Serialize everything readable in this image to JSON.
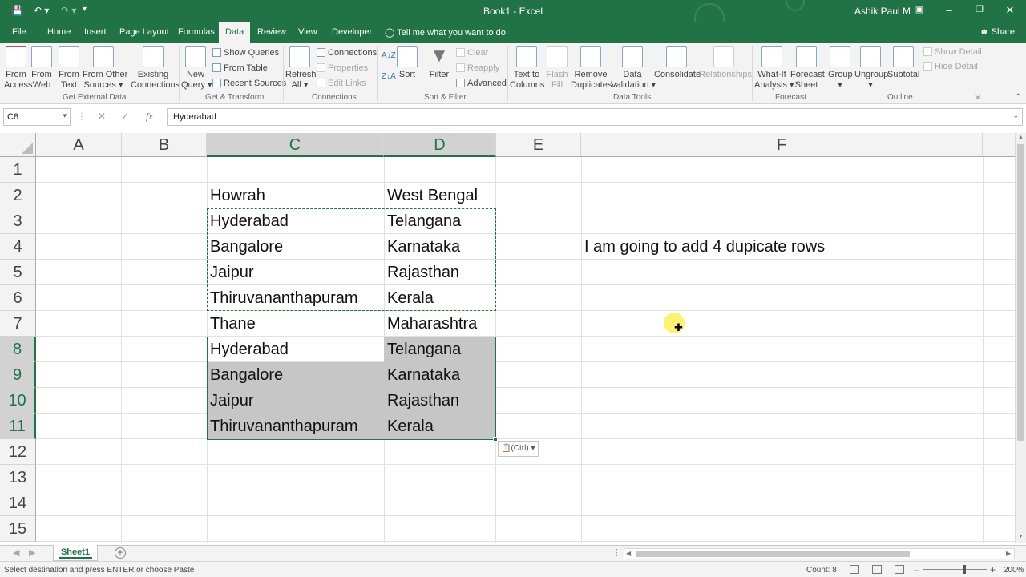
{
  "window": {
    "title": "Book1 - Excel",
    "user": "Ashik Paul M",
    "accent": "#217346"
  },
  "tabs": [
    "File",
    "Home",
    "Insert",
    "Page Layout",
    "Formulas",
    "Data",
    "Review",
    "View",
    "Developer"
  ],
  "active_tab": "Data",
  "tell_me": "Tell me what you want to do",
  "share": "Share",
  "ribbon": {
    "get_external": {
      "group": "Get External Data",
      "buttons": [
        "From\nAccess",
        "From\nWeb",
        "From\nText",
        "From Other\nSources ▾",
        "Existing\nConnections"
      ]
    },
    "get_transform": {
      "group": "Get & Transform",
      "new_query": "New\nQuery ▾",
      "items": [
        "Show Queries",
        "From Table",
        "Recent Sources"
      ]
    },
    "connections": {
      "group": "Connections",
      "refresh": "Refresh\nAll ▾",
      "items": [
        "Connections",
        "Properties",
        "Edit Links"
      ]
    },
    "sort_filter": {
      "group": "Sort & Filter",
      "sort": "Sort",
      "filter": "Filter",
      "items": [
        "Clear",
        "Reapply",
        "Advanced"
      ]
    },
    "data_tools": {
      "group": "Data Tools",
      "buttons": [
        "Text to\nColumns",
        "Flash\nFill",
        "Remove\nDuplicates",
        "Data\nValidation ▾",
        "Consolidate",
        "Relationships"
      ]
    },
    "forecast": {
      "group": "Forecast",
      "buttons": [
        "What-If\nAnalysis ▾",
        "Forecast\nSheet"
      ]
    },
    "outline": {
      "group": "Outline",
      "buttons": [
        "Group\n▾",
        "Ungroup\n▾",
        "Subtotal"
      ],
      "items": [
        "Show Detail",
        "Hide Detail"
      ]
    }
  },
  "formula_bar": {
    "name_box": "C8",
    "formula": "Hyderabad"
  },
  "columns": [
    "A",
    "B",
    "C",
    "D",
    "E",
    "F"
  ],
  "rows": [
    "1",
    "2",
    "3",
    "4",
    "5",
    "6",
    "7",
    "8",
    "9",
    "10",
    "11",
    "12",
    "13",
    "14",
    "15"
  ],
  "cells": {
    "C2": "Howrah",
    "D2": "West Bengal",
    "C3": "Hyderabad",
    "D3": "Telangana",
    "C4": "Bangalore",
    "D4": "Karnataka",
    "C5": "Jaipur",
    "D5": "Rajasthan",
    "C6": "Thiruvananthapuram",
    "D6": "Kerala",
    "C7": "Thane",
    "D7": "Maharashtra",
    "C8": "Hyderabad",
    "D8": "Telangana",
    "C9": "Bangalore",
    "D9": "Karnataka",
    "C10": "Jaipur",
    "D10": "Rajasthan",
    "C11": "Thiruvananthapuram",
    "D11": "Kerala",
    "F4": "I am going to add 4 dupicate rows"
  },
  "paste_options": "(Ctrl) ▾",
  "sheet_tab": "Sheet1",
  "status": {
    "message": "Select destination and press ENTER or choose Paste",
    "count": "Count: 8",
    "zoom": "200%"
  }
}
